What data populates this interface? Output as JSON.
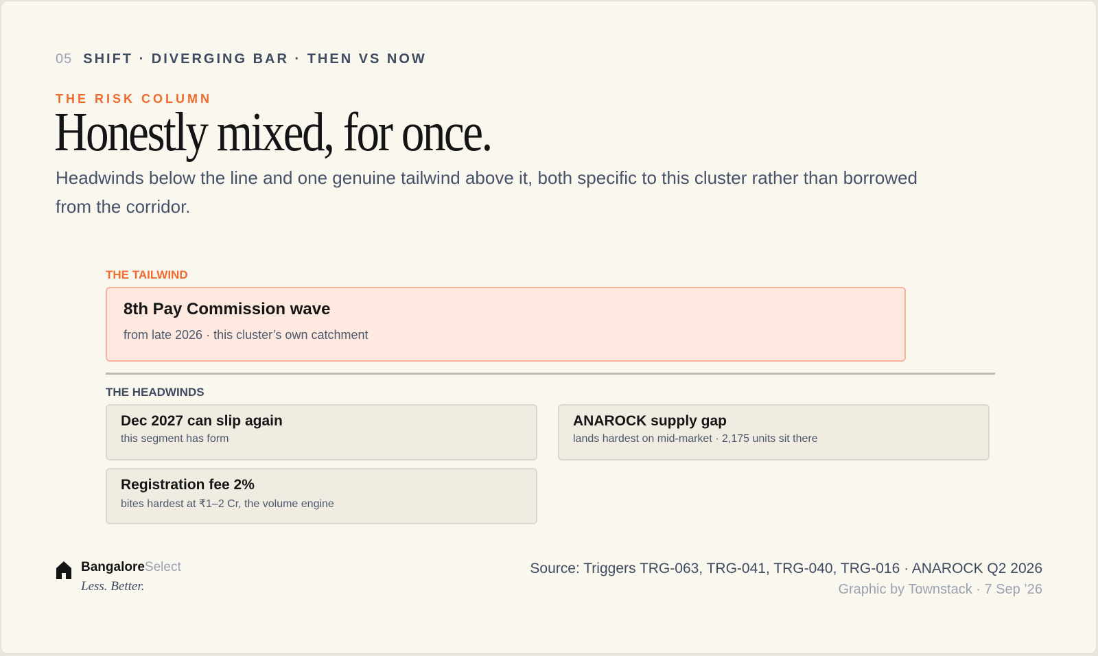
{
  "header": {
    "number": "05",
    "kicker": "SHIFT · DIVERGING BAR · THEN VS NOW",
    "eyebrow": "THE RISK COLUMN",
    "title": "Honestly mixed, for once.",
    "subtitle": "Headwinds below the line and one genuine tailwind above it, both specific to this cluster rather than borrowed from the corridor."
  },
  "tailwind": {
    "label": "THE TAILWIND",
    "title": "8th Pay Commission wave",
    "detail": "from late 2026 · this cluster’s own catchment"
  },
  "headwinds": {
    "label": "THE HEADWINDS",
    "items": [
      {
        "title": "Dec 2027 can slip again",
        "detail": "this segment has form"
      },
      {
        "title": "ANAROCK supply gap",
        "detail": "lands hardest on mid-market · 2,175 units sit there"
      },
      {
        "title": "Registration fee 2%",
        "detail": "bites hardest at ₹1–2 Cr, the volume engine"
      }
    ]
  },
  "footer": {
    "brand_bold": "Bangalore",
    "brand_light": "Select",
    "tagline": "Less. Better.",
    "source": "Source: Triggers TRG-063, TRG-041, TRG-040, TRG-016 · ANAROCK Q2 2026",
    "credit": "Graphic by Townstack · 7 Sep ’26"
  },
  "colors": {
    "accent": "#ee6a2d",
    "tailwind_fill": "#fde9df",
    "headwind_fill": "#f0ece1",
    "background": "#faf7ef"
  },
  "icons": [
    "house-icon"
  ]
}
